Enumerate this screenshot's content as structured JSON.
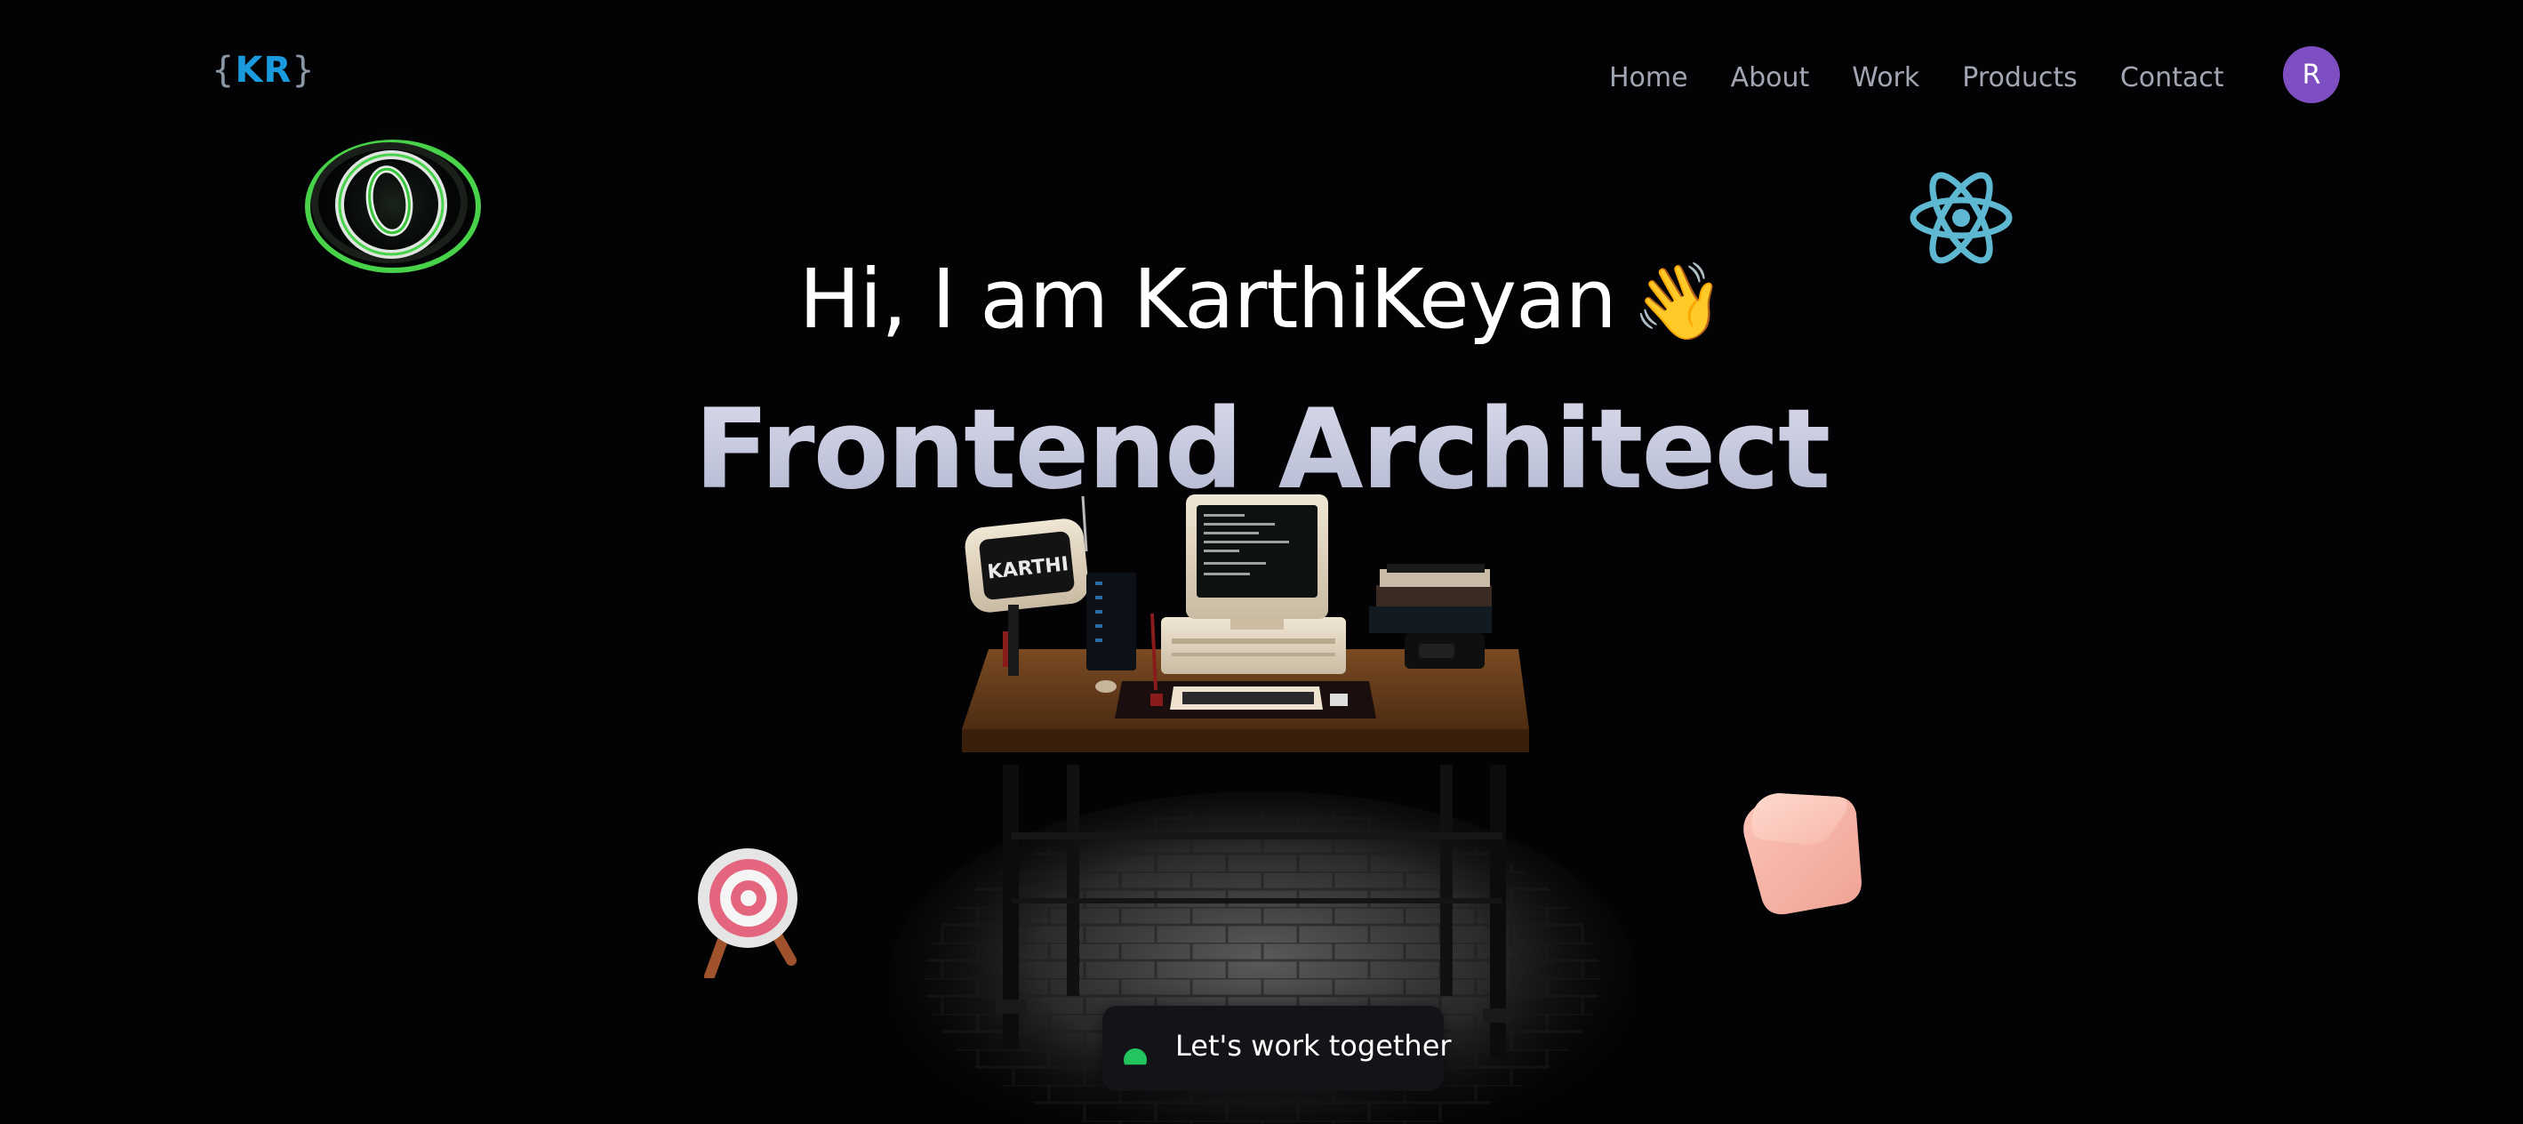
{
  "brand": {
    "logo_text": "KR",
    "logo_open_brace": "{",
    "logo_close_brace": "}",
    "logo_color": "#1a9be0"
  },
  "nav": {
    "items": [
      {
        "label": "Home"
      },
      {
        "label": "About"
      },
      {
        "label": "Work"
      },
      {
        "label": "Products"
      },
      {
        "label": "Contact"
      }
    ],
    "avatar_initial": "R",
    "avatar_color": "#7e4fc3"
  },
  "hero": {
    "greeting": "Hi, I am KarthiKeyan",
    "wave_emoji": "👋",
    "role": "Frontend Architect",
    "monitor_label": "KARTHI",
    "cta_label": "Let's work together",
    "cta_status_color": "#22c55e"
  },
  "decorations": {
    "top_left": "ring-icon",
    "top_right": "react-icon",
    "bottom_left": "target-icon",
    "bottom_right": "cube-icon"
  }
}
